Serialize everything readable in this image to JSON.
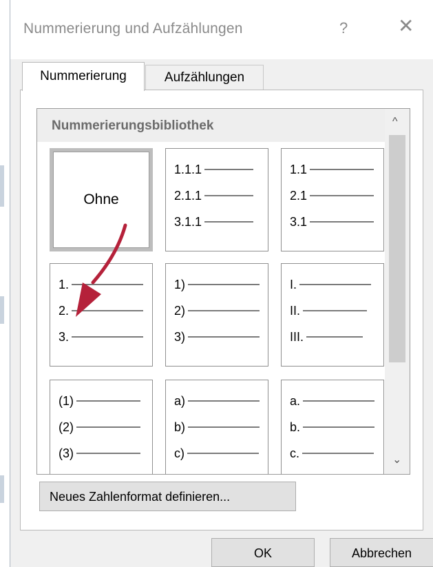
{
  "dialog": {
    "title": "Nummerierung und Aufzählungen",
    "help_glyph": "?",
    "close_glyph": "✕"
  },
  "tabs": [
    {
      "label": "Nummerierung",
      "active": true
    },
    {
      "label": "Aufzählungen",
      "active": false
    }
  ],
  "library": {
    "title": "Nummerierungsbibliothek",
    "tiles": [
      {
        "none_label": "Ohne",
        "selected": true
      },
      {
        "items": [
          "1.1.1",
          "2.1.1",
          "3.1.1"
        ]
      },
      {
        "items": [
          "1.1",
          "2.1",
          "3.1"
        ]
      },
      {
        "items": [
          "1.",
          "2.",
          "3."
        ]
      },
      {
        "items": [
          "1)",
          "2)",
          "3)"
        ]
      },
      {
        "items": [
          "I.",
          "II.",
          "III."
        ]
      },
      {
        "items": [
          "(1)",
          "(2)",
          "(3)"
        ]
      },
      {
        "items": [
          "a)",
          "b)",
          "c)"
        ]
      },
      {
        "items": [
          "a.",
          "b.",
          "c."
        ]
      }
    ]
  },
  "scroll": {
    "up_glyph": "^",
    "down_glyph": "⌄"
  },
  "buttons": {
    "define": "Neues Zahlenformat definieren...",
    "ok": "OK",
    "cancel": "Abbrechen"
  },
  "annotation": {
    "arrow_color": "#b5213a"
  }
}
